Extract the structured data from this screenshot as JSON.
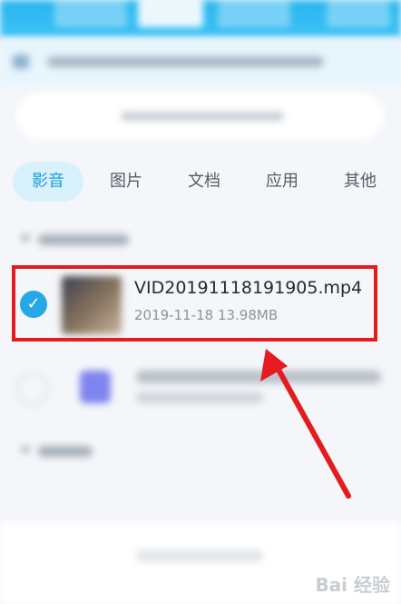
{
  "tabs": [
    {
      "label": "影音",
      "active": true
    },
    {
      "label": "图片",
      "active": false
    },
    {
      "label": "文档",
      "active": false
    },
    {
      "label": "应用",
      "active": false
    },
    {
      "label": "其他",
      "active": false
    }
  ],
  "selected_file": {
    "name": "VID20191118191905.mp4",
    "meta": "2019-11-18   13.98MB",
    "selected": true,
    "check_glyph": "✓"
  },
  "colors": {
    "accent": "#24a9e6",
    "highlight": "#e41b1f",
    "header": "#27b4ef"
  },
  "watermark": "Bai 经验"
}
